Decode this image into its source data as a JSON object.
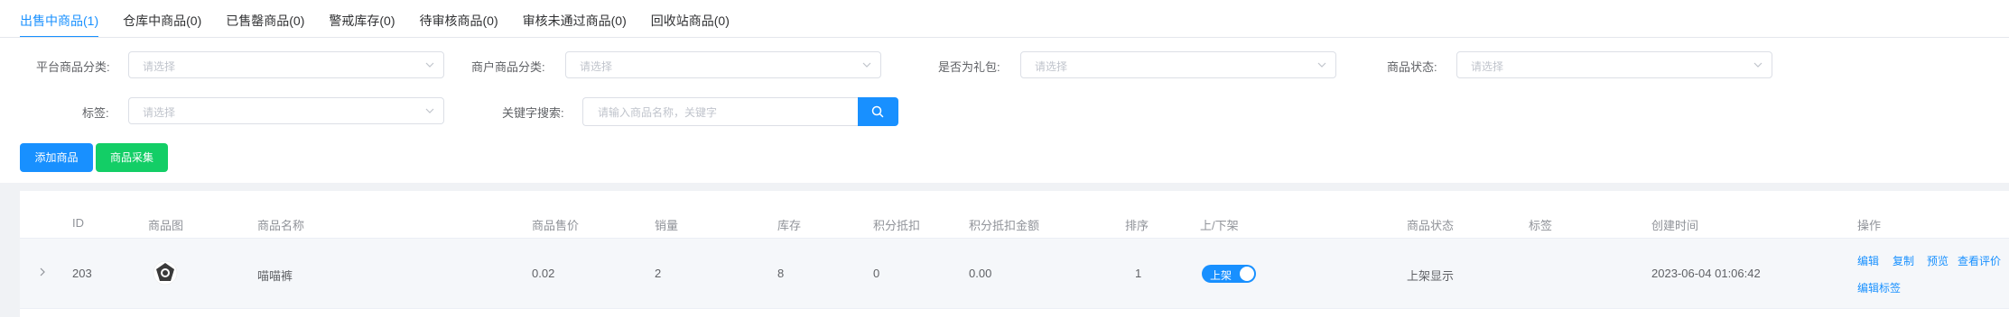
{
  "tabs": [
    {
      "label": "出售中商品(1)",
      "active": true
    },
    {
      "label": "仓库中商品(0)",
      "active": false
    },
    {
      "label": "已售罄商品(0)",
      "active": false
    },
    {
      "label": "警戒库存(0)",
      "active": false
    },
    {
      "label": "待审核商品(0)",
      "active": false
    },
    {
      "label": "审核未通过商品(0)",
      "active": false
    },
    {
      "label": "回收站商品(0)",
      "active": false
    }
  ],
  "filters": {
    "platform_category": {
      "label": "平台商品分类:",
      "placeholder": "请选择"
    },
    "merchant_category": {
      "label": "商户商品分类:",
      "placeholder": "请选择"
    },
    "is_gift": {
      "label": "是否为礼包:",
      "placeholder": "请选择"
    },
    "product_status": {
      "label": "商品状态:",
      "placeholder": "请选择"
    },
    "tag": {
      "label": "标签:",
      "placeholder": "请选择"
    },
    "keyword": {
      "label": "关键字搜索:",
      "placeholder": "请输入商品名称，关键字",
      "value": ""
    }
  },
  "actions": {
    "add_product": "添加商品",
    "collect_product": "商品采集"
  },
  "table": {
    "columns": [
      "ID",
      "商品图",
      "商品名称",
      "商品售价",
      "销量",
      "库存",
      "积分抵扣",
      "积分抵扣金额",
      "排序",
      "上/下架",
      "商品状态",
      "标签",
      "创建时间",
      "操作"
    ],
    "rows": [
      {
        "id": "203",
        "name": "喵喵裤",
        "price": "0.02",
        "sales": "2",
        "stock": "8",
        "points_deduct": "0",
        "points_amount": "0.00",
        "sort": "1",
        "shelf_switch": "上架",
        "status": "上架显示",
        "tags": "",
        "created": "2023-06-04 01:06:42",
        "ops": {
          "edit": "编辑",
          "copy": "复制",
          "preview": "预览",
          "reviews": "查看评价",
          "edit_tags": "编辑标签"
        }
      }
    ]
  },
  "colors": {
    "primary": "#1890ff",
    "success": "#13ce66"
  }
}
